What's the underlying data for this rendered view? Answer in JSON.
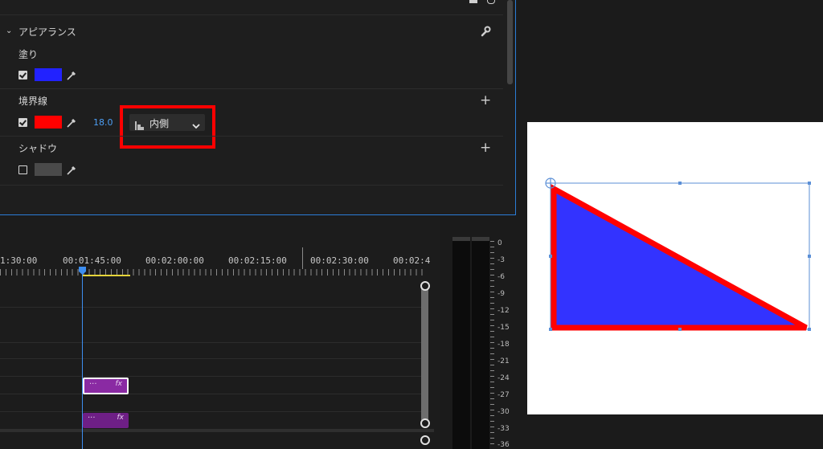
{
  "essential_graphics": {
    "section_title": "アピアランス",
    "fill": {
      "label": "塗り",
      "checked": true,
      "color": "#2222ff"
    },
    "stroke": {
      "label": "境界線",
      "checked": true,
      "color": "#ff0000",
      "width_value": "18.0",
      "position": "内側"
    },
    "shadow": {
      "label": "シャドウ",
      "checked": false,
      "color": "#4a4a4a"
    }
  },
  "timeline": {
    "timecodes": [
      "1:30:00",
      "00:01:45:00",
      "00:02:00:00",
      "00:02:15:00",
      "00:02:30:00",
      "00:02:4"
    ],
    "clips": [
      {
        "dots": "···",
        "fx": "fx"
      },
      {
        "dots": "···",
        "fx": "fx"
      }
    ]
  },
  "audio_meter": {
    "scale": [
      "0",
      "-3",
      "-6",
      "-9",
      "-12",
      "-15",
      "-18",
      "-21",
      "-24",
      "-27",
      "-30",
      "-33",
      "-36"
    ]
  },
  "program_monitor": {
    "shape_fill": "#3333ff",
    "shape_stroke": "#ff0000"
  },
  "highlight_color": "#ff0000"
}
